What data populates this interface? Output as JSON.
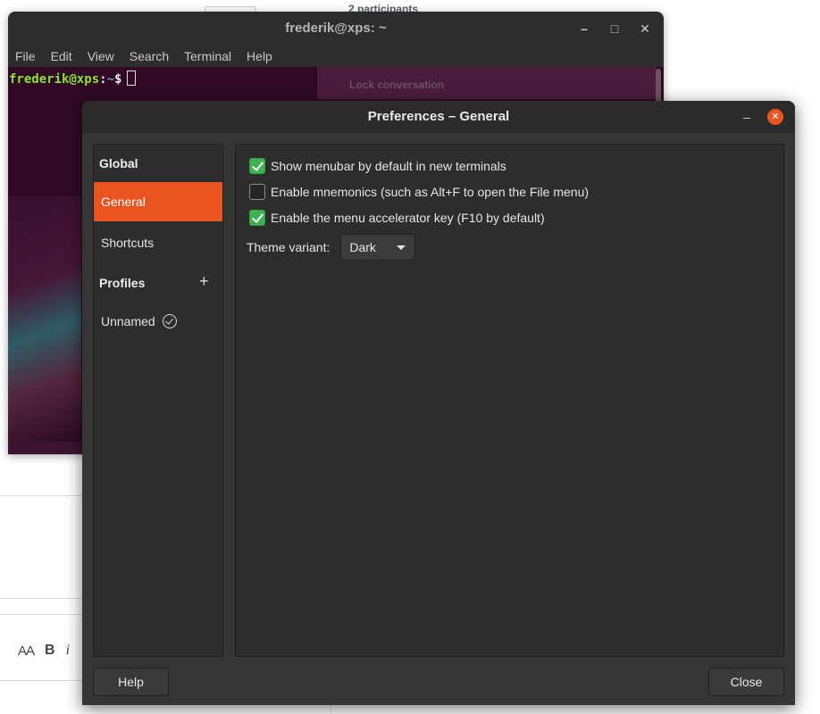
{
  "background": {
    "participants": "2 participants",
    "toolbar": {
      "aa": "AA",
      "bold": "B",
      "italic": "i"
    }
  },
  "terminal": {
    "title": "frederik@xps: ~",
    "menu": [
      "File",
      "Edit",
      "View",
      "Search",
      "Terminal",
      "Help"
    ],
    "prompt_user": "frederik@xps",
    "prompt_sep": ":",
    "prompt_path": "~",
    "prompt_symbol": "$",
    "lock_text": "Lock conversation",
    "colors": {
      "bg": "#300a24",
      "user": "#8ae234",
      "path": "#729fcf"
    }
  },
  "prefs": {
    "title": "Preferences – General",
    "sidebar": {
      "global_header": "Global",
      "general": "General",
      "shortcuts": "Shortcuts",
      "profiles_header": "Profiles",
      "profile_name": "Unnamed"
    },
    "options": [
      {
        "label": "Show menubar by default in new terminals",
        "checked": true
      },
      {
        "label": "Enable mnemonics (such as Alt+F to open the File menu)",
        "checked": false
      },
      {
        "label": "Enable the menu accelerator key (F10 by default)",
        "checked": true
      }
    ],
    "theme_label": "Theme variant:",
    "theme_value": "Dark",
    "help_button": "Help",
    "close_button": "Close",
    "colors": {
      "accent": "#e95420",
      "check": "#3eb34f"
    }
  }
}
